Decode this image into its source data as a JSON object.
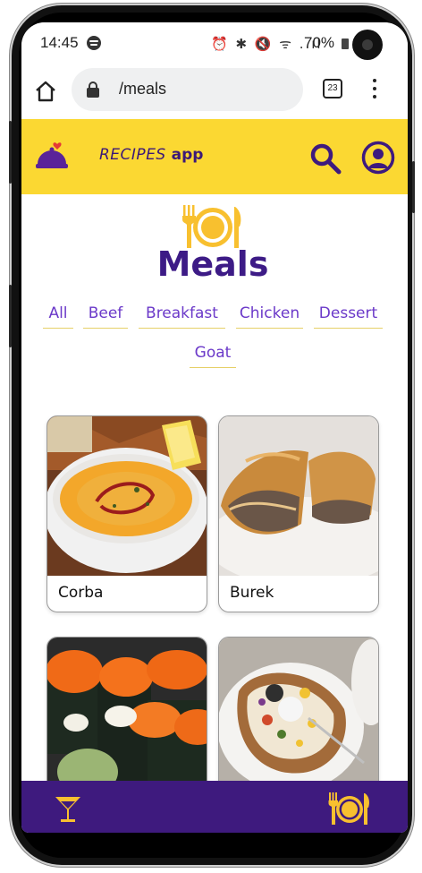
{
  "status_bar": {
    "time": "14:45",
    "icons": "⏰ ✱ 🔇 ᯤ ..ıl",
    "battery": "70%"
  },
  "browser": {
    "url": "/meals",
    "tab_count": "23"
  },
  "header": {
    "brand_italic": "RECIPES ",
    "brand_bold": "app"
  },
  "page": {
    "title": "Meals"
  },
  "categories": [
    "All",
    "Beef",
    "Breakfast",
    "Chicken",
    "Dessert",
    "Goat"
  ],
  "meals": [
    {
      "name": "Corba"
    },
    {
      "name": "Burek"
    },
    {
      "name": ""
    },
    {
      "name": ""
    }
  ],
  "colors": {
    "accent_yellow": "#fbd832",
    "brand_purple": "#3e1a7e",
    "category_purple": "#6b39c9"
  },
  "icons": {
    "logo": "cloche-heart-icon",
    "search": "search-icon",
    "profile": "user-circle-icon",
    "drinks_tab": "cocktail-icon",
    "meals_tab": "plate-cutlery-icon"
  }
}
